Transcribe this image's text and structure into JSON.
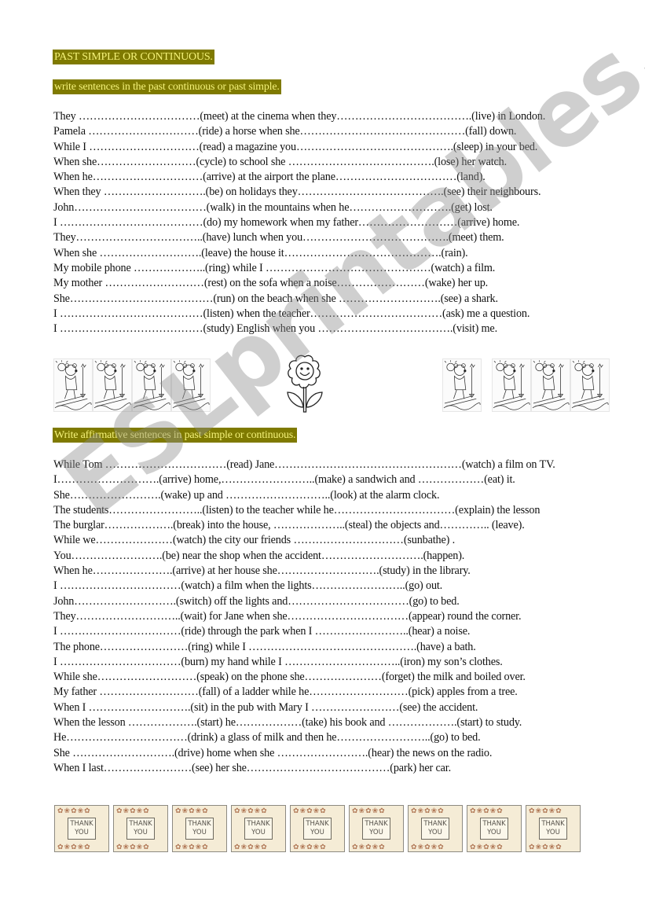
{
  "title": "PAST SIMPLE OR CONTINUOUS.",
  "section1": {
    "instruction": "write sentences in the past continuous or past simple.",
    "lines": [
      "They ……………………………(meet) at the cinema when they……………………………….(live)  in London.",
      "Pamela …………………………(ride) a horse when she………………………………………(fall) down.",
      "While I …………………………(read) a magazine you…………………………………….(sleep) in your bed.",
      "When she………………………(cycle) to school she ………………………………….(lose) her watch.",
      "When he…………………………(arrive) at the airport the plane……………………………(land).",
      "When they ……………………….(be) on holidays they………………………………….(see) their neighbours.",
      "John………………………………(walk) in the mountains when he……………………….(get) lost.",
      "I …………………………………(do) my homework when my father………………………(arrive) home.",
      "They……………………………..(have) lunch when you………………………………….(meet) them.",
      "When she ……………………….(leave) the house it…………………………………….(rain).",
      "My mobile phone ………………..(ring) while I ………………………………………(watch) a film.",
      "My mother ………………………(rest) on the sofa when a noise……………………(wake) her up.",
      "She…………………………………(run) on the beach when she ……………………….(see) a shark.",
      "I …………………………………(listen) when the teacher………………………………(ask) me a question.",
      "I …………………………………(study) English when you ……………………………….(visit) me."
    ]
  },
  "section2": {
    "instruction": "Write affirmative sentences in past simple or continuous.",
    "lines": [
      "While Tom ……………………………(read) Jane……………………………………………(watch) a film on TV.",
      "I……………………….(arrive) home,……………………..(make) a sandwich and ………………(eat) it.",
      "She…………………….(wake) up and ………………………..(look) at the alarm clock.",
      "The students……………………..(listen) to the teacher while he……………………………(explain) the lesson",
      "The burglar……………….(break) into the house, ………………..(steal) the objects and………….. (leave).",
      "While we…………………(watch) the city our friends …………………………(sunbathe) .",
      "You…………………….(be) near the shop when the accident……………………….(happen).",
      "When he………………….(arrive) at her house she……………………….(study) in the library.",
      "I ……………………………(watch) a film when the lights……………………..(go) out.",
      "John……………………….(switch) off the lights and……………………………(go) to bed.",
      "They………………………..(wait) for Jane when she……………………………(appear) round the corner.",
      "I ……………………………(ride) through the park when I ……………………..(hear) a noise.",
      "The phone……………………(ring) while I ……………………………………….(have) a bath.",
      "I ……………………………(burn) my hand while I …………………………..(iron) my son’s clothes.",
      "While she………………………(speak) on the phone she…………………(forget) the milk and boiled over.",
      "My father ………………………(fall) of a ladder while he………………………(pick) apples from a tree.",
      "When I ……………………….(sit) in the pub with Mary I ……………………(see) the accident.",
      "When the lesson ……………….(start) he………………(take) his book and ……………….(start) to study.",
      "He……………………………(drink) a glass of milk and then he……………………..(go) to bed.",
      "She ……………………….(drive) home when she …………………….(hear) the news on the radio.",
      "When I last……………………(see) her she…………………………………(park) her car."
    ]
  },
  "card_text": [
    "THANK",
    "YOU"
  ],
  "watermark": "ESLprintables.com",
  "colors": {
    "heading_bg": "#7f7a00",
    "heading_text": "#f4f27a",
    "card_bg": "#f5ecd6"
  }
}
